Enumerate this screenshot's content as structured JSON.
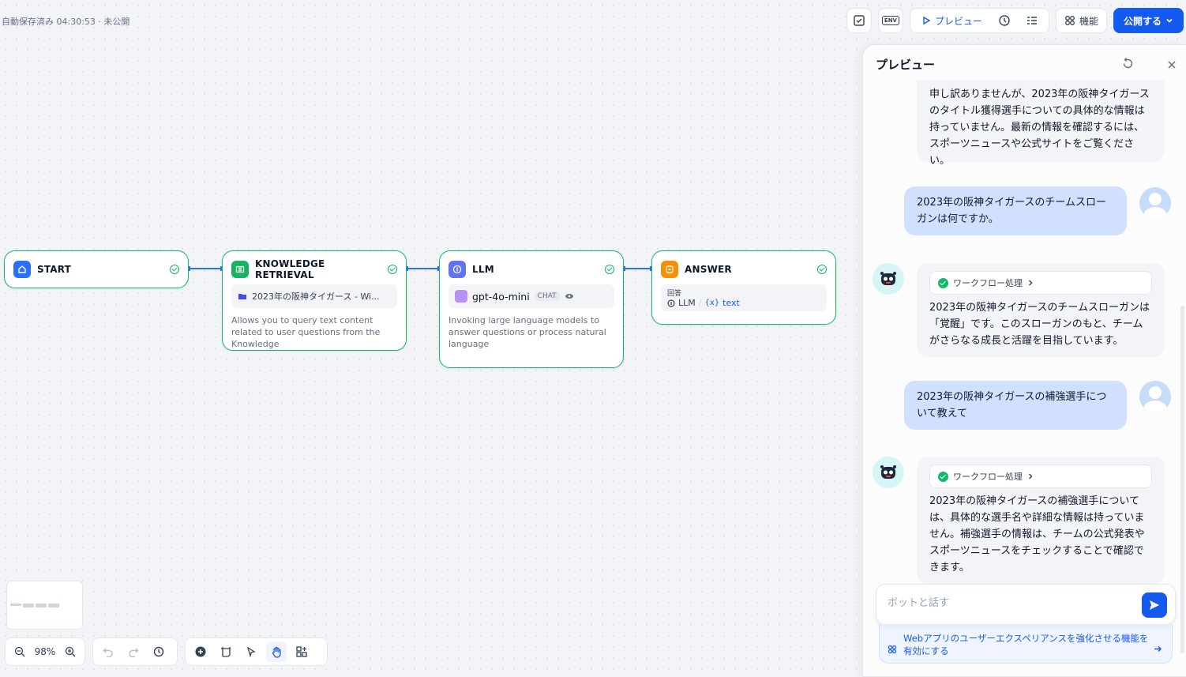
{
  "status": "自動保存済み 04:30:53 · 未公開",
  "toolbar": {
    "env_label": "ENV",
    "preview_label": "プレビュー",
    "features_label": "機能",
    "publish_label": "公開する"
  },
  "nodes": {
    "start": {
      "title": "START",
      "icon_color": "#2970ff"
    },
    "knowledge": {
      "title": "KNOWLEDGE RETRIEVAL",
      "icon_color": "#16b364",
      "dataset": "2023年の阪神タイガース - Wi...",
      "desc": "Allows you to query text content related to user questions from the Knowledge"
    },
    "llm": {
      "title": "LLM",
      "icon_color": "#6172f3",
      "model": "gpt-4o-mini",
      "mode": "CHAT",
      "desc": "Invoking large language models to answer questions or process natural language"
    },
    "answer": {
      "title": "ANSWER",
      "icon_color": "#f79009",
      "field_label": "回答",
      "var_node": "LLM",
      "var_name": "text"
    }
  },
  "zoom": "98%",
  "preview": {
    "title": "プレビュー",
    "messages": [
      {
        "role": "bot",
        "text": "申し訳ありませんが、2023年の阪神タイガースのタイトル獲得選手についての具体的な情報は持っていません。最新の情報を確認するには、スポーツニュースや公式サイトをご覧ください。"
      },
      {
        "role": "user",
        "text": "2023年の阪神タイガースのチームスローガンは何ですか。"
      },
      {
        "role": "bot",
        "workflow": "ワークフロー処理",
        "text": "2023年の阪神タイガースのチームスローガンは「覚醒」です。このスローガンのもと、チームがさらなる成長と活躍を目指しています。"
      },
      {
        "role": "user",
        "text": "2023年の阪神タイガースの補強選手について教えて"
      },
      {
        "role": "bot",
        "workflow": "ワークフロー処理",
        "text": "2023年の阪神タイガースの補強選手については、具体的な選手名や詳細な情報は持っていません。補強選手の情報は、チームの公式発表やスポーツニュースをチェックすることで確認できます。"
      }
    ],
    "input_placeholder": "ボットと話す",
    "feature_hint": "Webアプリのユーザーエクスペリアンスを強化させる機能を有効にする"
  }
}
